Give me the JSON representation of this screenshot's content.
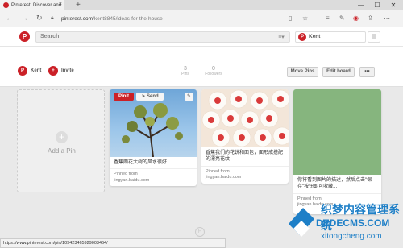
{
  "browser": {
    "tab_title": "Pinterest: Discover and",
    "tab_close": "×",
    "new_tab": "+",
    "url_domain": "pinterest.com",
    "url_path": "/kent8845/ideas-for-the-house",
    "status_url": "https://www.pinterest.com/pin/109423465929003464/",
    "win_minimize": "—",
    "win_maximize": "☐",
    "win_close": "✕"
  },
  "pinterest": {
    "search_placeholder": "Search",
    "user_name": "Kent",
    "logo_letter": "P"
  },
  "board": {
    "collaborator": "Kent",
    "invite_label": "Invite",
    "pins_count": "3",
    "pins_label": "Pins",
    "followers_count": "0",
    "followers_label": "Followers",
    "move_pins": "Move Pins",
    "edit_board": "Edit board",
    "more": "•••"
  },
  "add_pin": {
    "label": "Add a Pin",
    "plus": "+"
  },
  "pins": [
    {
      "description": "香蕉雨花大树的风水很好",
      "pinned_from": "Pinned from",
      "source": "jingyan.baidu.com",
      "pinit_label": "Pinit",
      "send_label": "Send",
      "edit_icon": "✎"
    },
    {
      "description": "香蕉我们的花饼和面包，面形成搭配的漂亮花纹",
      "pinned_from": "Pinned from",
      "source": "jingyan.baidu.com"
    },
    {
      "description": "你将看到图片的描述，然后点击\"保存\"按钮即可收藏...",
      "pinned_from": "Pinned from",
      "source": "jingyan.baidu.com"
    }
  ],
  "watermark": {
    "line1": "织梦内容管理系统",
    "line2": "DEDECMS.COM",
    "line3": "xitongcheng.com"
  },
  "colors": {
    "brand": "#cb2027",
    "watermark": "#1e7fc7"
  }
}
